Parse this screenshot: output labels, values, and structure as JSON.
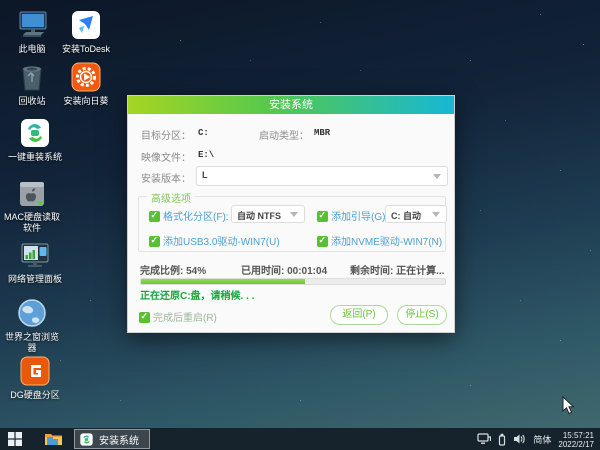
{
  "desktop": {
    "icons": [
      {
        "id": "this-pc",
        "label": "此电脑"
      },
      {
        "id": "todesk",
        "label": "安装ToDesk"
      },
      {
        "id": "recycle-bin",
        "label": "回收站"
      },
      {
        "id": "sunflower",
        "label": "安装向日葵"
      },
      {
        "id": "onekey-reinstall",
        "label": "一键重装系统"
      },
      {
        "id": "mac-disk-reader",
        "label": "MAC硬盘读取软件"
      },
      {
        "id": "network-panel",
        "label": "网络管理面板"
      },
      {
        "id": "world-browser",
        "label": "世界之窗浏览器"
      },
      {
        "id": "dg-partition",
        "label": "DG硬盘分区"
      }
    ]
  },
  "dialog": {
    "title": "安装系统",
    "fields": {
      "target_partition_label": "目标分区：",
      "target_partition_value": "C:",
      "boot_type_label": "启动类型：",
      "boot_type_value": "MBR",
      "image_file_label": "映像文件：",
      "image_file_value": "E:\\",
      "install_version_label": "安装版本：",
      "install_version_value": "L"
    },
    "advanced": {
      "group_title": "高级选项",
      "format_label": "格式化分区(F):",
      "format_value": "自动 NTFS",
      "add_boot_label": "添加引导(G):",
      "add_boot_value": "C: 自动",
      "usb3_label": "添加USB3.0驱动-WIN7(U)",
      "nvme_label": "添加NVME驱动-WIN7(N)"
    },
    "progress": {
      "percent": 54,
      "percent_label": "完成比例: 54%",
      "elapsed_label": "已用时间: 00:01:04",
      "remaining_label": "剩余时间: 正在计算...",
      "status_text": "正在还原C:盘，请稍候. . .",
      "restart_label": "完成后重启(R)"
    },
    "buttons": {
      "back": "返回(P)",
      "stop": "停止(S)"
    }
  },
  "taskbar": {
    "task_label": "安装系统",
    "tray": {
      "ime": "简体",
      "time": "15:57:21",
      "date": "2022/2/17"
    }
  },
  "colors": {
    "header_gradient_left": "#a6d521",
    "header_gradient_right": "#17b7d7",
    "accent_green": "#56c230",
    "label_blue": "#4ba0d3",
    "status_green": "#16a63c",
    "taskbar_bg": "#16232d"
  }
}
